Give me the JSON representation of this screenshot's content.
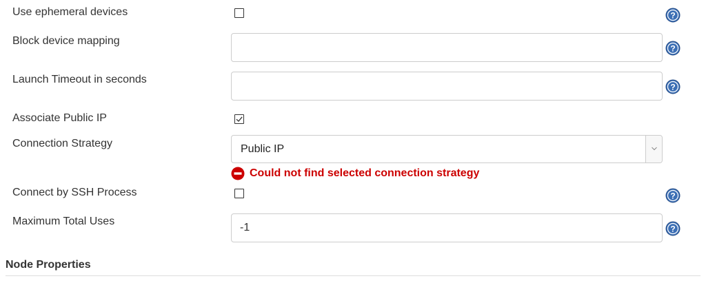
{
  "fields": {
    "ephemeral": {
      "label": "Use ephemeral devices",
      "checked": false
    },
    "block_device": {
      "label": "Block device mapping",
      "value": ""
    },
    "launch_timeout": {
      "label": "Launch Timeout in seconds",
      "value": ""
    },
    "public_ip": {
      "label": "Associate Public IP",
      "checked": true
    },
    "connection_strategy": {
      "label": "Connection Strategy",
      "selected": "Public IP",
      "error": "Could not find selected connection strategy"
    },
    "ssh_process": {
      "label": "Connect by SSH Process",
      "checked": false
    },
    "max_uses": {
      "label": "Maximum Total Uses",
      "value": "-1"
    }
  },
  "section": {
    "title": "Node Properties"
  },
  "icons": {
    "help": "help-icon",
    "error": "error-icon",
    "dropdown": "chevron-down-icon"
  },
  "colors": {
    "error": "#cc0000",
    "help": "#3c6fb5"
  }
}
